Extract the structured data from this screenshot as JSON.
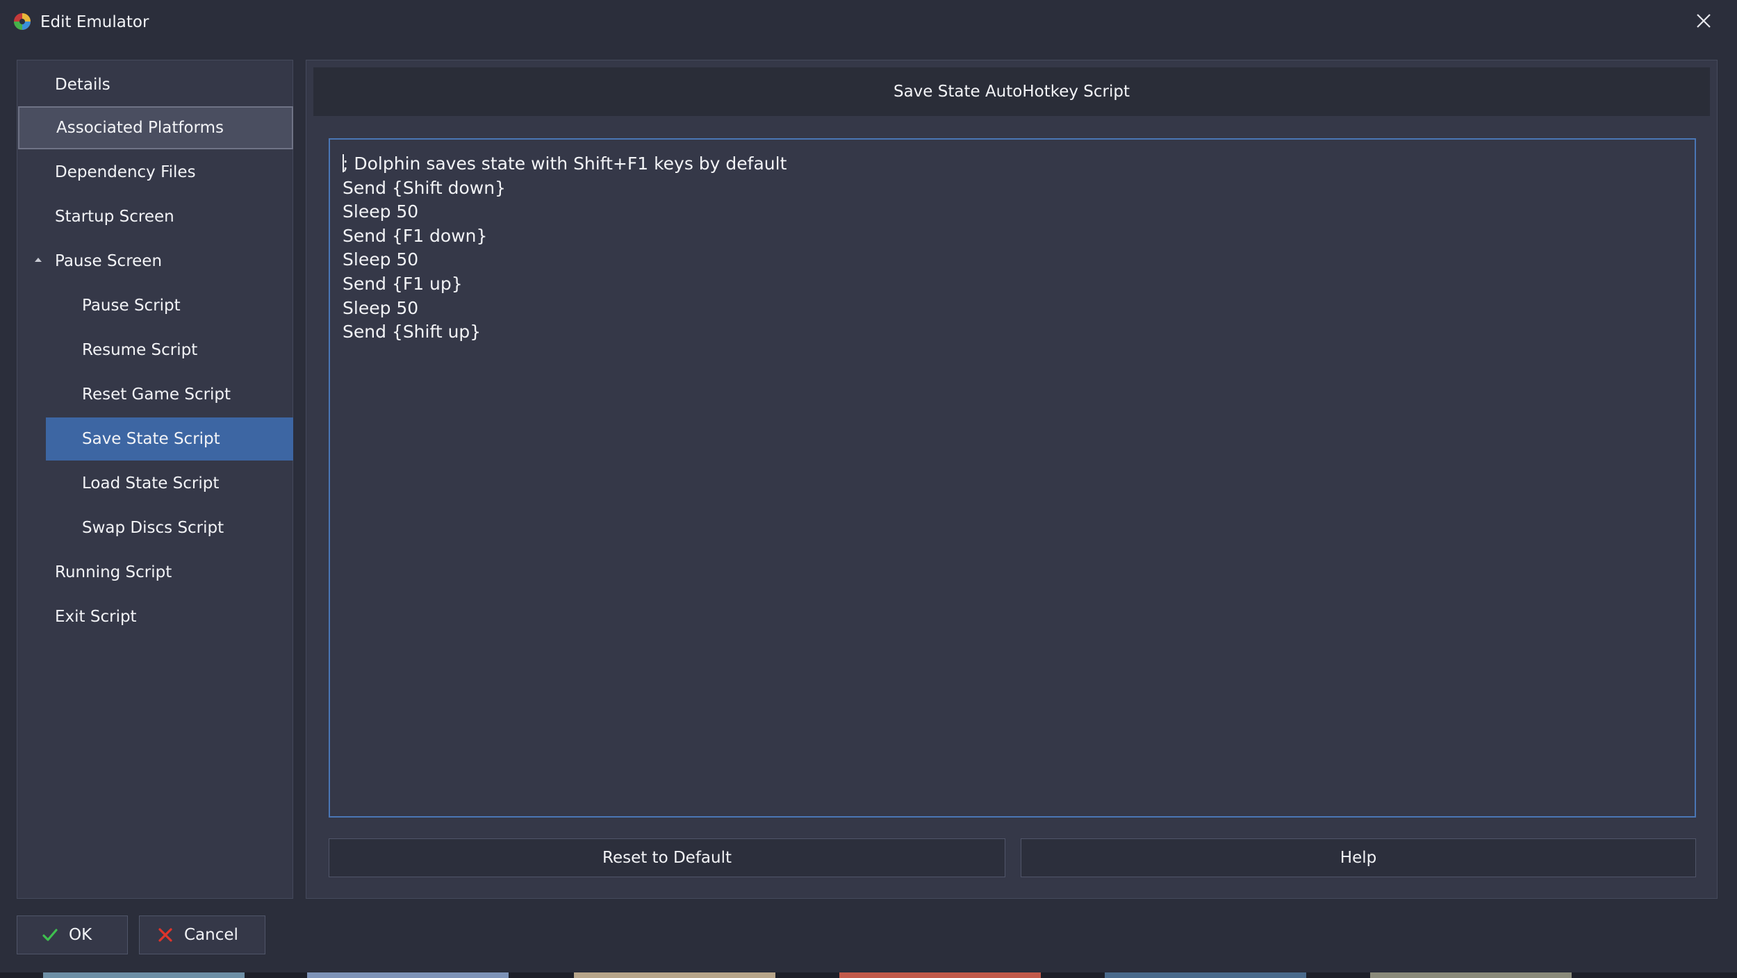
{
  "window": {
    "title": "Edit Emulator"
  },
  "sidebar": {
    "items": [
      {
        "label": "Details"
      },
      {
        "label": "Associated Platforms"
      },
      {
        "label": "Dependency Files"
      },
      {
        "label": "Startup Screen"
      },
      {
        "label": "Pause Screen",
        "expanded": true
      },
      {
        "label": "Pause Script"
      },
      {
        "label": "Resume Script"
      },
      {
        "label": "Reset Game Script"
      },
      {
        "label": "Save State Script",
        "selected": true
      },
      {
        "label": "Load State Script"
      },
      {
        "label": "Swap Discs Script"
      },
      {
        "label": "Running Script"
      },
      {
        "label": "Exit Script"
      }
    ]
  },
  "main": {
    "header": "Save State AutoHotkey Script",
    "script_lines": [
      "; Dolphin saves state with Shift+F1 keys by default",
      "Send {Shift down}",
      "Sleep 50",
      "Send {F1 down}",
      "Sleep 50",
      "Send {F1 up}",
      "Sleep 50",
      "Send {Shift up}"
    ],
    "reset_label": "Reset to Default",
    "help_label": "Help"
  },
  "footer": {
    "ok_label": "OK",
    "cancel_label": "Cancel"
  },
  "colors": {
    "background": "#2b2e3b",
    "panel": "#353848",
    "selected": "#3d66a3",
    "ok_check": "#3fbf4f",
    "cancel_x": "#e0342b"
  },
  "icons": {
    "app": "emulator-app-icon",
    "close": "close-icon",
    "ok": "checkmark-icon",
    "cancel": "x-mark-icon",
    "expander": "collapse-triangle-icon"
  }
}
